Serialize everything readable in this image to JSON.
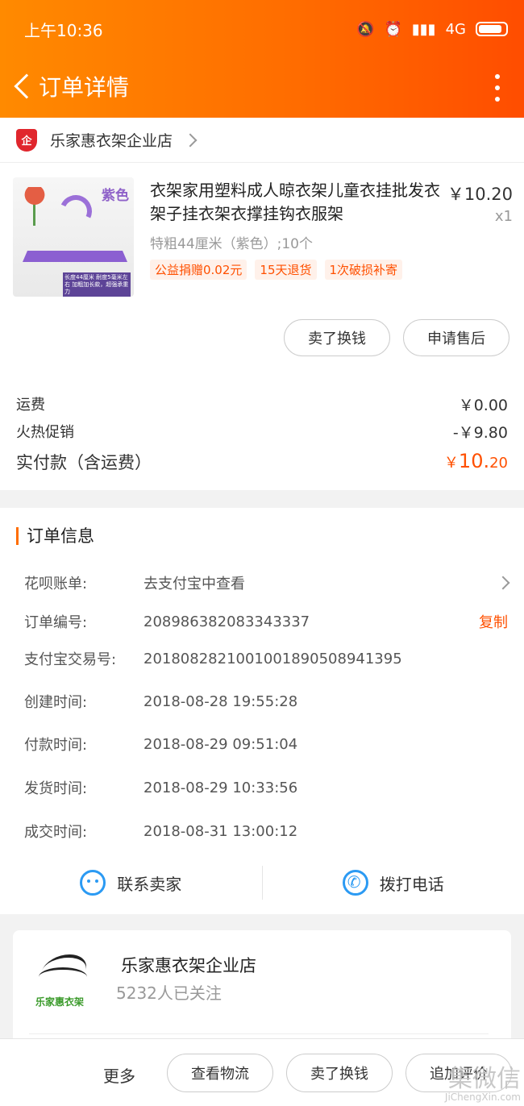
{
  "status_bar": {
    "time": "上午10:36",
    "network": "4G"
  },
  "nav": {
    "title": "订单详情"
  },
  "shop": {
    "badge": "企",
    "name": "乐家惠衣架企业店"
  },
  "product": {
    "image_tag": "紫色",
    "image_caption": "长度44厘米 耐度5毫米左右 加粗加长款，超强承重力",
    "title": "衣架家用塑料成人晾衣架儿童衣挂批发衣架子挂衣架衣撑挂钩衣服架",
    "price": "￥10.20",
    "qty": "x1",
    "sku": "特粗44厘米（紫色）;10个",
    "tags": [
      "公益捐赠0.02元",
      "15天退货",
      "1次破损补寄"
    ]
  },
  "actions": {
    "sell": "卖了换钱",
    "after_sale": "申请售后"
  },
  "fees": {
    "shipping_label": "运费",
    "shipping": "￥0.00",
    "promo_label": "火热促销",
    "promo": "-￥9.80",
    "total_label": "实付款（含运费）",
    "total_symbol": "￥",
    "total_int": "10.",
    "total_dec": "20"
  },
  "order_info": {
    "title": "订单信息",
    "rows": [
      {
        "key": "花呗账单:",
        "value": "去支付宝中查看"
      },
      {
        "key": "订单编号:",
        "value": "208986382083343337",
        "action": "复制"
      },
      {
        "key": "支付宝交易号:",
        "value": "2018082821001001890508941395"
      },
      {
        "key": "创建时间:",
        "value": "2018-08-28 19:55:28"
      },
      {
        "key": "付款时间:",
        "value": "2018-08-29 09:51:04"
      },
      {
        "key": "发货时间:",
        "value": "2018-08-29 10:33:56"
      },
      {
        "key": "成交时间:",
        "value": "2018-08-31 13:00:12"
      }
    ],
    "contact_seller": "联系卖家",
    "call": "拨打电话"
  },
  "store": {
    "logo_text": "乐家惠衣架",
    "name": "乐家惠衣架企业店",
    "followers": "5232人已关注"
  },
  "bottom_bar": {
    "more": "更多",
    "logistics": "查看物流",
    "sell": "卖了换钱",
    "review": "追加评价"
  },
  "watermark": {
    "main": "集微信",
    "sub": "JiChengXin.com"
  },
  "colors": {
    "accent": "#ff5000",
    "header_start": "#ff8a00",
    "header_end": "#ff4d00",
    "link_blue": "#2b9af3"
  }
}
